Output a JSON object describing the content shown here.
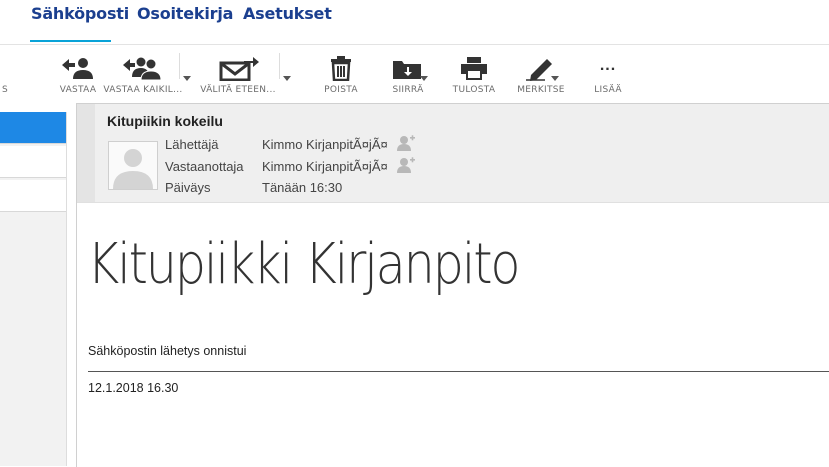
{
  "nav": {
    "tabs": [
      {
        "label": "Sähköposti",
        "active": true
      },
      {
        "label": "Osoitekirja",
        "active": false
      },
      {
        "label": "Asetukset",
        "active": false
      }
    ]
  },
  "toolbar": {
    "partial_left": "S",
    "reply": "VASTAA",
    "reply_all": "VASTAA KAIKIL...",
    "forward": "VÄLITÄ ETEEN...",
    "delete": "POISTA",
    "move": "SIIRRÄ",
    "print": "TULOSTA",
    "mark": "MERKITSE",
    "more": "LISÄÄ",
    "more_glyph": "..."
  },
  "message": {
    "subject": "Kitupiikin kokeilu",
    "from_label": "Lähettäjä",
    "from_value": "Kimmo KirjanpitÃ¤jÃ¤",
    "to_label": "Vastaanottaja",
    "to_value": "Kimmo KirjanpitÃ¤jÃ¤",
    "date_label": "Päiväys",
    "date_value": "Tänään 16:30",
    "body_title": "Kitupiikki Kirjanpito",
    "body_line": "Sähköpostin lähetys onnistui",
    "body_date": "12.1.2018 16.30"
  },
  "colors": {
    "accent": "#1b3f8f",
    "tab_underline": "#0aa3d8",
    "selection": "#1e88e5"
  }
}
